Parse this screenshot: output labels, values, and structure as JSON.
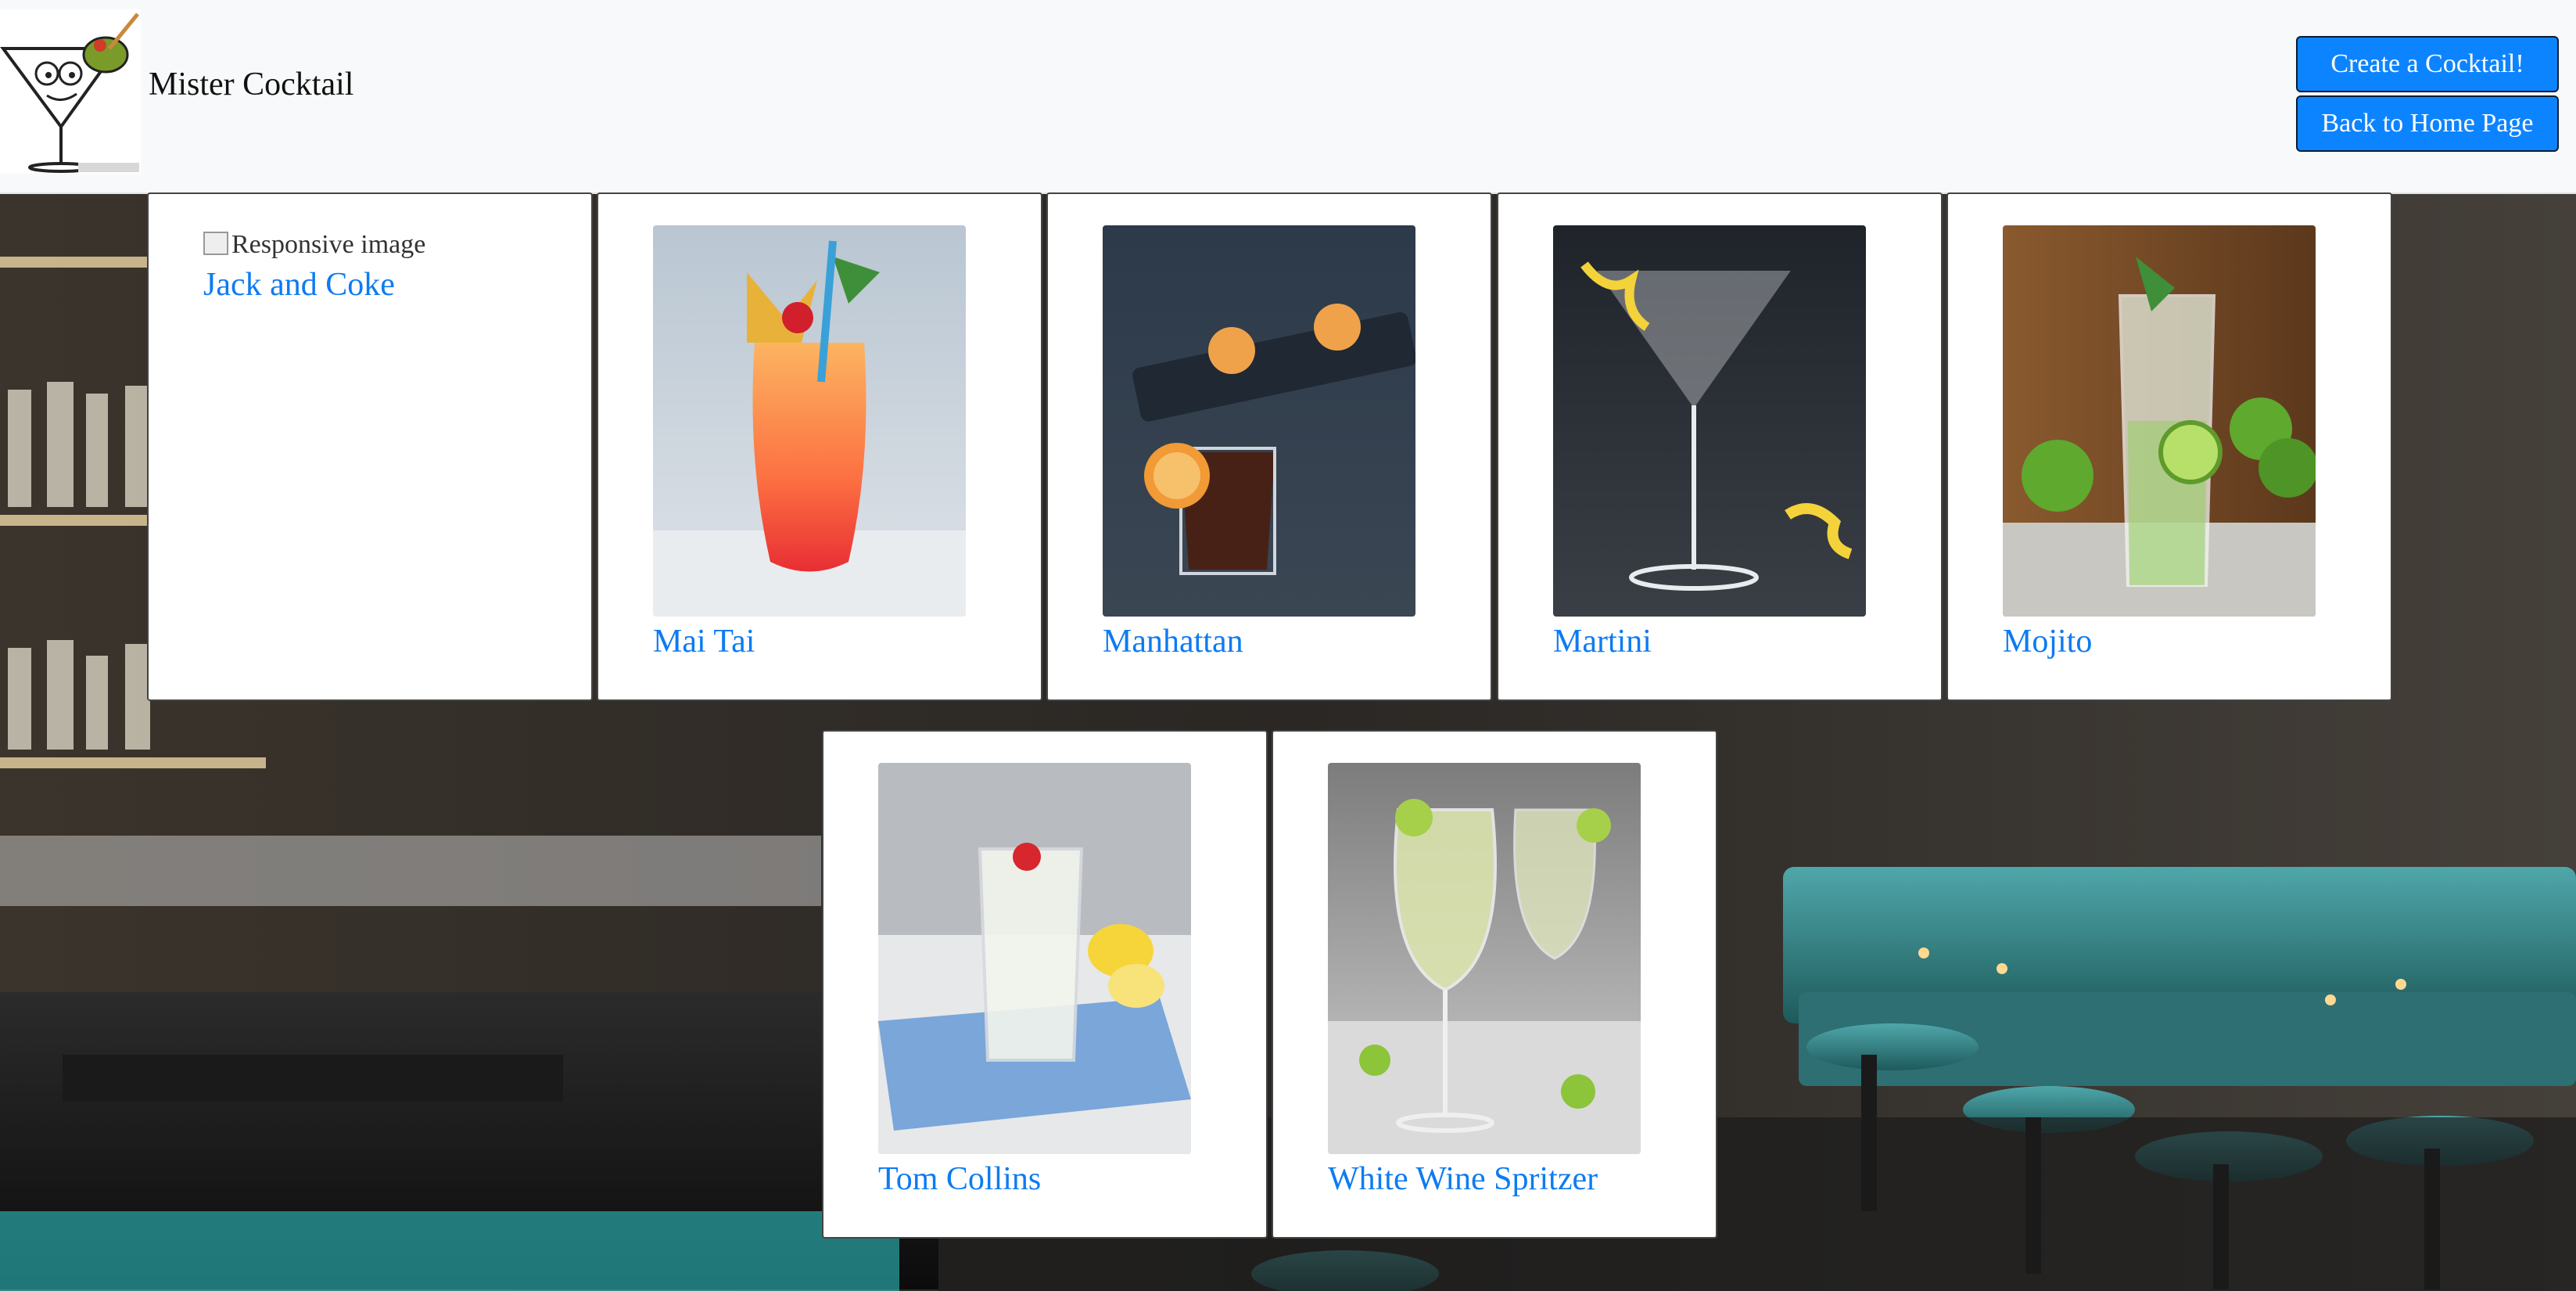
{
  "header": {
    "brand": "Mister Cocktail",
    "create_label": "Create a Cocktail!",
    "home_label": "Back to Home Page"
  },
  "colors": {
    "primary": "#0d84ff",
    "link": "#0d7bf2",
    "header_bg": "#f8f9fa"
  },
  "cocktails": [
    {
      "name": "Jack and Coke",
      "image_alt": "Responsive image",
      "image_broken": true
    },
    {
      "name": "Mai Tai"
    },
    {
      "name": "Manhattan"
    },
    {
      "name": "Martini"
    },
    {
      "name": "Mojito"
    },
    {
      "name": "Tom Collins"
    },
    {
      "name": "White Wine Spritzer"
    }
  ]
}
